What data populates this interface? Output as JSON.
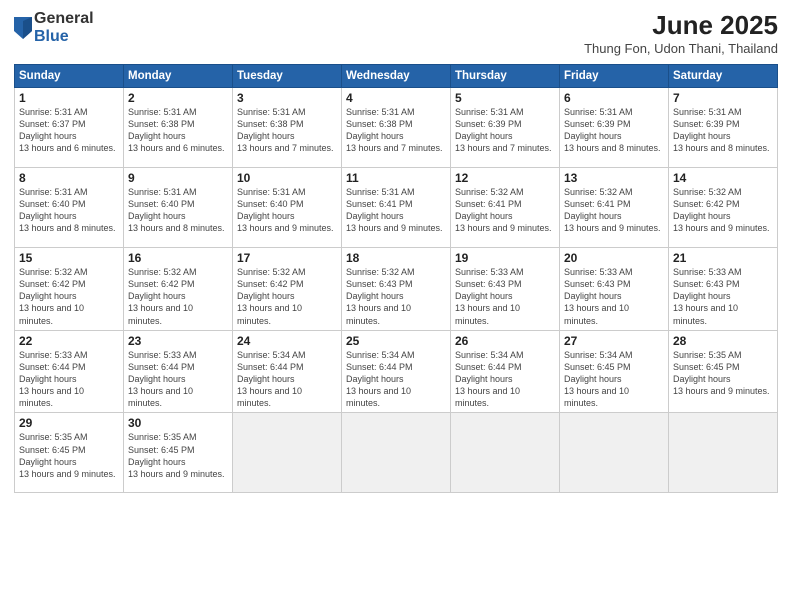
{
  "logo": {
    "general": "General",
    "blue": "Blue"
  },
  "title": "June 2025",
  "subtitle": "Thung Fon, Udon Thani, Thailand",
  "headers": [
    "Sunday",
    "Monday",
    "Tuesday",
    "Wednesday",
    "Thursday",
    "Friday",
    "Saturday"
  ],
  "weeks": [
    [
      {
        "day": "1",
        "rise": "5:31 AM",
        "set": "6:37 PM",
        "daylight": "13 hours and 6 minutes."
      },
      {
        "day": "2",
        "rise": "5:31 AM",
        "set": "6:38 PM",
        "daylight": "13 hours and 6 minutes."
      },
      {
        "day": "3",
        "rise": "5:31 AM",
        "set": "6:38 PM",
        "daylight": "13 hours and 7 minutes."
      },
      {
        "day": "4",
        "rise": "5:31 AM",
        "set": "6:38 PM",
        "daylight": "13 hours and 7 minutes."
      },
      {
        "day": "5",
        "rise": "5:31 AM",
        "set": "6:39 PM",
        "daylight": "13 hours and 7 minutes."
      },
      {
        "day": "6",
        "rise": "5:31 AM",
        "set": "6:39 PM",
        "daylight": "13 hours and 8 minutes."
      },
      {
        "day": "7",
        "rise": "5:31 AM",
        "set": "6:39 PM",
        "daylight": "13 hours and 8 minutes."
      }
    ],
    [
      {
        "day": "8",
        "rise": "5:31 AM",
        "set": "6:40 PM",
        "daylight": "13 hours and 8 minutes."
      },
      {
        "day": "9",
        "rise": "5:31 AM",
        "set": "6:40 PM",
        "daylight": "13 hours and 8 minutes."
      },
      {
        "day": "10",
        "rise": "5:31 AM",
        "set": "6:40 PM",
        "daylight": "13 hours and 9 minutes."
      },
      {
        "day": "11",
        "rise": "5:31 AM",
        "set": "6:41 PM",
        "daylight": "13 hours and 9 minutes."
      },
      {
        "day": "12",
        "rise": "5:32 AM",
        "set": "6:41 PM",
        "daylight": "13 hours and 9 minutes."
      },
      {
        "day": "13",
        "rise": "5:32 AM",
        "set": "6:41 PM",
        "daylight": "13 hours and 9 minutes."
      },
      {
        "day": "14",
        "rise": "5:32 AM",
        "set": "6:42 PM",
        "daylight": "13 hours and 9 minutes."
      }
    ],
    [
      {
        "day": "15",
        "rise": "5:32 AM",
        "set": "6:42 PM",
        "daylight": "13 hours and 10 minutes."
      },
      {
        "day": "16",
        "rise": "5:32 AM",
        "set": "6:42 PM",
        "daylight": "13 hours and 10 minutes."
      },
      {
        "day": "17",
        "rise": "5:32 AM",
        "set": "6:42 PM",
        "daylight": "13 hours and 10 minutes."
      },
      {
        "day": "18",
        "rise": "5:32 AM",
        "set": "6:43 PM",
        "daylight": "13 hours and 10 minutes."
      },
      {
        "day": "19",
        "rise": "5:33 AM",
        "set": "6:43 PM",
        "daylight": "13 hours and 10 minutes."
      },
      {
        "day": "20",
        "rise": "5:33 AM",
        "set": "6:43 PM",
        "daylight": "13 hours and 10 minutes."
      },
      {
        "day": "21",
        "rise": "5:33 AM",
        "set": "6:43 PM",
        "daylight": "13 hours and 10 minutes."
      }
    ],
    [
      {
        "day": "22",
        "rise": "5:33 AM",
        "set": "6:44 PM",
        "daylight": "13 hours and 10 minutes."
      },
      {
        "day": "23",
        "rise": "5:33 AM",
        "set": "6:44 PM",
        "daylight": "13 hours and 10 minutes."
      },
      {
        "day": "24",
        "rise": "5:34 AM",
        "set": "6:44 PM",
        "daylight": "13 hours and 10 minutes."
      },
      {
        "day": "25",
        "rise": "5:34 AM",
        "set": "6:44 PM",
        "daylight": "13 hours and 10 minutes."
      },
      {
        "day": "26",
        "rise": "5:34 AM",
        "set": "6:44 PM",
        "daylight": "13 hours and 10 minutes."
      },
      {
        "day": "27",
        "rise": "5:34 AM",
        "set": "6:45 PM",
        "daylight": "13 hours and 10 minutes."
      },
      {
        "day": "28",
        "rise": "5:35 AM",
        "set": "6:45 PM",
        "daylight": "13 hours and 9 minutes."
      }
    ],
    [
      {
        "day": "29",
        "rise": "5:35 AM",
        "set": "6:45 PM",
        "daylight": "13 hours and 9 minutes."
      },
      {
        "day": "30",
        "rise": "5:35 AM",
        "set": "6:45 PM",
        "daylight": "13 hours and 9 minutes."
      },
      null,
      null,
      null,
      null,
      null
    ]
  ]
}
